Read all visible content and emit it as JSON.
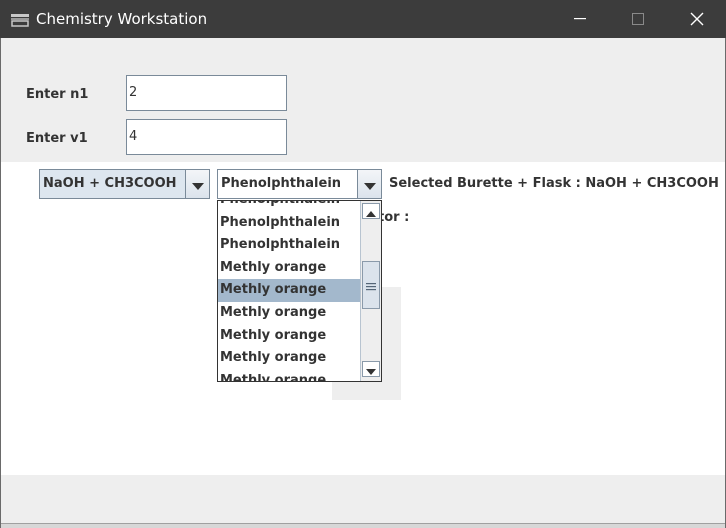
{
  "window": {
    "title": "Chemistry Workstation",
    "icon": "coffee-cup-icon",
    "controls": [
      "minimize-icon",
      "maximize-icon",
      "close-icon"
    ]
  },
  "form": {
    "n1_label": "Enter n1",
    "n1_value": "2",
    "v1_label": "Enter v1",
    "v1_value": "4"
  },
  "burette_combo": {
    "selected": "NaOH + CH3COOH"
  },
  "indicator_combo": {
    "selected": "Phenolphthalein",
    "options": [
      "Phenolphthalein",
      "Phenolphthalein",
      "Phenolphthalein",
      "Methly orange",
      "Methly orange",
      "Methly orange",
      "Methly orange",
      "Methly orange",
      "Methly orange"
    ],
    "highlighted_index": 4
  },
  "status": {
    "selected_text": "Selected Burette + Flask : NaOH + CH3COOH",
    "indicator_text": "tor :"
  },
  "colors": {
    "titlebar": "#3c3c3c",
    "panel": "#eeeeee",
    "highlight": "#a3b8cc",
    "border": "#7a8a99"
  }
}
